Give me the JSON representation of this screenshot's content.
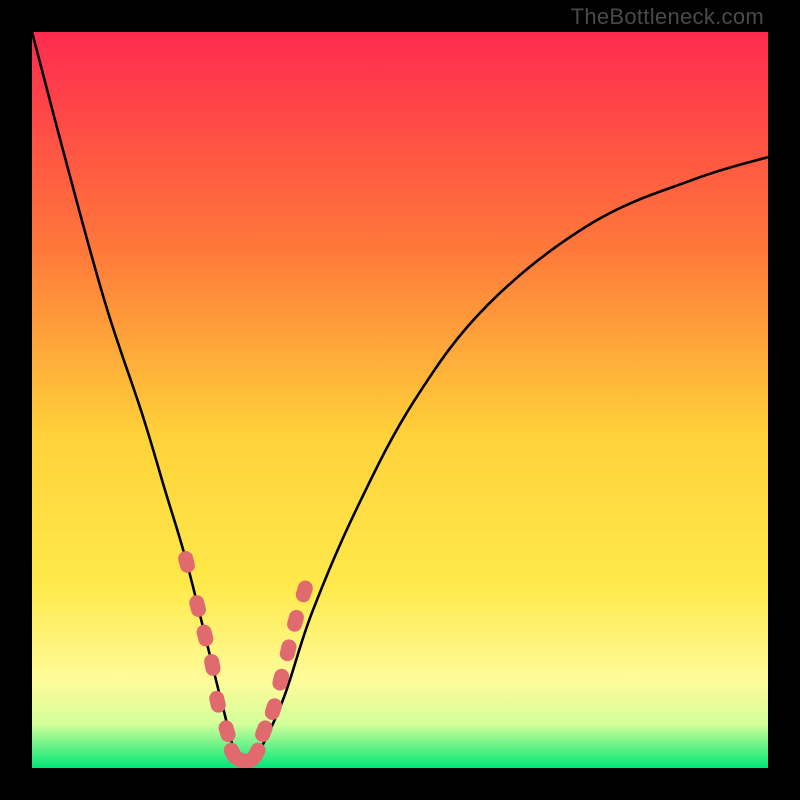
{
  "watermark": "TheBottleneck.com",
  "colors": {
    "bg_top": "#ff2a4f",
    "bg_mid1": "#ff7a3a",
    "bg_mid2": "#ffd23a",
    "bg_mid3": "#ffe94a",
    "bg_mid4": "#fffb9a",
    "bg_bottom_top": "#d4ff9a",
    "bg_bottom": "#00e678",
    "curve": "#000000",
    "marker": "#e06a6e"
  },
  "chart_data": {
    "type": "line",
    "title": "",
    "xlabel": "",
    "ylabel": "",
    "xlim": [
      0,
      100
    ],
    "ylim": [
      0,
      100
    ],
    "series": [
      {
        "name": "bottleneck-curve",
        "x": [
          0,
          5,
          10,
          15,
          18,
          21,
          24,
          26,
          28,
          30,
          34,
          38,
          44,
          52,
          62,
          76,
          90,
          100
        ],
        "y": [
          100,
          81,
          63,
          48,
          38,
          28,
          16,
          8,
          1,
          1,
          9,
          21,
          35,
          50,
          63,
          74,
          80,
          83
        ]
      }
    ],
    "markers": {
      "name": "highlighted-points",
      "x": [
        21.0,
        22.5,
        23.5,
        24.5,
        25.2,
        26.5,
        27.3,
        28.5,
        29.5,
        30.5,
        31.5,
        32.8,
        33.8,
        34.8,
        35.8,
        37.0
      ],
      "y": [
        28.0,
        22.0,
        18.0,
        14.0,
        9.0,
        5.0,
        2.0,
        1.0,
        1.0,
        2.0,
        5.0,
        8.0,
        12.0,
        16.0,
        20.0,
        24.0
      ]
    }
  }
}
